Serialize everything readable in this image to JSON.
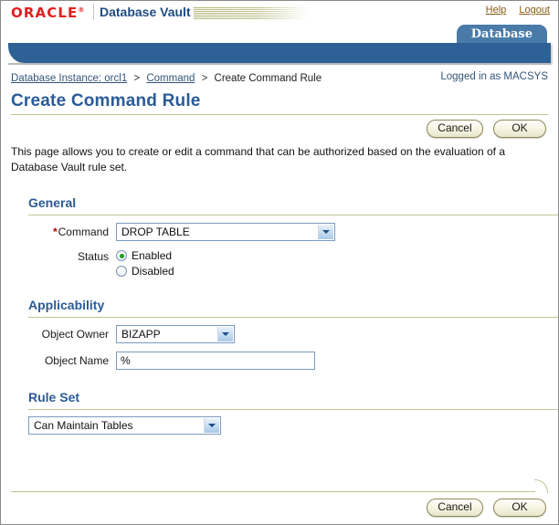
{
  "branding": {
    "logo_text": "ORACLE",
    "logo_mark": "®",
    "product_name": "Database Vault",
    "help_label": "Help",
    "logout_label": "Logout",
    "accent_red": "#e02020",
    "accent_blue": "#1f4b82"
  },
  "tabs": [
    {
      "label": "Database",
      "selected": true
    }
  ],
  "breadcrumb": {
    "items": [
      {
        "label": "Database Instance: orcl1",
        "link": true
      },
      {
        "label": "Command",
        "link": true
      },
      {
        "label": "Create Command Rule",
        "link": false
      }
    ],
    "separator": ">"
  },
  "session": {
    "logged_in_text": "Logged in as MACSYS"
  },
  "page": {
    "title": "Create Command Rule",
    "intro": "This page allows you to create or edit a command that can be authorized based on the evaluation of a Database Vault rule set."
  },
  "actions": {
    "cancel_label": "Cancel",
    "ok_label": "OK"
  },
  "sections": {
    "general": {
      "title": "General",
      "command": {
        "label": "Command",
        "required_marker": "*",
        "value": "DROP TABLE"
      },
      "status": {
        "label": "Status",
        "options": [
          {
            "label": "Enabled",
            "selected": true
          },
          {
            "label": "Disabled",
            "selected": false
          }
        ]
      }
    },
    "applicability": {
      "title": "Applicability",
      "object_owner": {
        "label": "Object Owner",
        "value": "BIZAPP"
      },
      "object_name": {
        "label": "Object Name",
        "value": "%",
        "placeholder": ""
      }
    },
    "rule_set": {
      "title": "Rule Set",
      "value": "Can Maintain Tables"
    }
  }
}
